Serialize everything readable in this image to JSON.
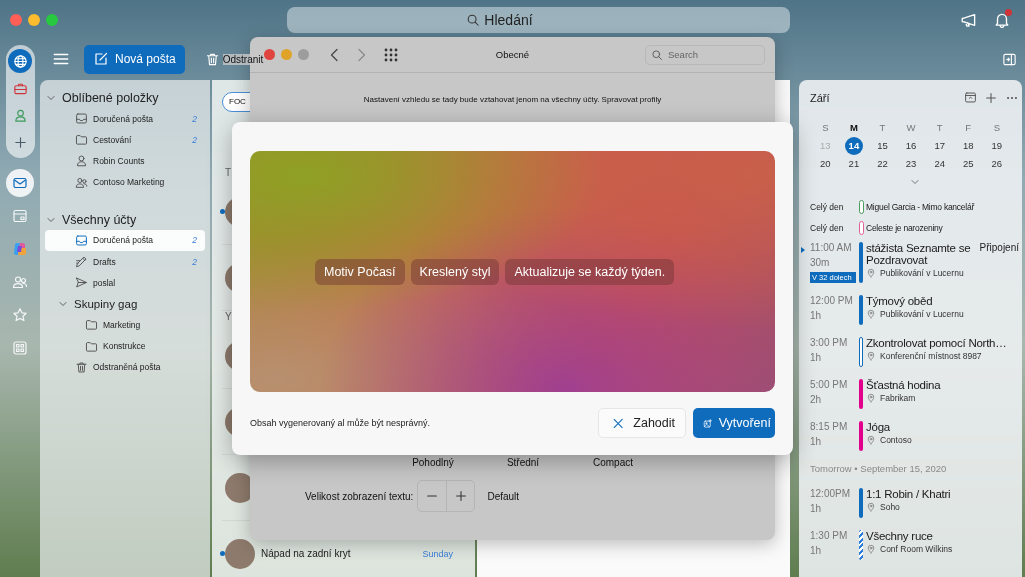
{
  "search": {
    "placeholder": "Hledání"
  },
  "notifications": {
    "alert": true
  },
  "rail": {
    "accounts": [
      {
        "kind": "globe",
        "selected": true
      },
      {
        "kind": "briefcase",
        "selected": false
      },
      {
        "kind": "person",
        "selected": false
      },
      {
        "kind": "add",
        "selected": false
      }
    ],
    "apps": [
      {
        "kind": "mail",
        "selected": true
      },
      {
        "kind": "calendar",
        "selected": false
      },
      {
        "kind": "copilot",
        "selected": false
      },
      {
        "kind": "people",
        "selected": false
      },
      {
        "kind": "star",
        "selected": false
      },
      {
        "kind": "apps",
        "selected": false
      }
    ]
  },
  "toolbar": {
    "new_mail": "Nová pošta",
    "delete": "Odstranit"
  },
  "folders": [
    {
      "label": "Oblíbené položky",
      "expanded": true,
      "children": [
        {
          "label": "Doručená pošta",
          "kind": "inbox",
          "count": "2",
          "selected": false
        },
        {
          "label": "Cestování",
          "kind": "folder",
          "count": "2",
          "selected": false
        },
        {
          "label": "Robin Counts",
          "kind": "person",
          "selected": false
        },
        {
          "label": "Contoso Marketing",
          "kind": "group",
          "selected": false
        }
      ]
    },
    {
      "label": "Všechny účty",
      "expanded": true,
      "children": [
        {
          "label": "Doručená pošta",
          "kind": "inbox",
          "count": "2",
          "selected": true
        },
        {
          "label": "Drafts",
          "kind": "drafts",
          "count": "2",
          "selected": false
        },
        {
          "label": "poslal",
          "kind": "sent",
          "selected": false
        },
        {
          "label": "Skupiny gag",
          "kind": "subgroup",
          "expanded": true,
          "children": [
            {
              "label": "Marketing",
              "kind": "folder",
              "selected": false
            },
            {
              "label": "Konstrukce",
              "kind": "folder",
              "selected": false
            }
          ]
        },
        {
          "label": "Odstraněná pošta",
          "kind": "trash",
          "selected": false
        }
      ]
    }
  ],
  "message_list": {
    "filter": "FOC",
    "groups": [
      {
        "label": "T",
        "messages": [
          {
            "unread": true
          },
          {
            "unread": false
          }
        ]
      },
      {
        "label": "Y",
        "messages": [
          {
            "unread": false
          },
          {
            "unread": false
          },
          {
            "unread": false
          },
          {
            "unread": true,
            "subject": "Nápad na zadní kryt",
            "time": "Sunday"
          }
        ]
      }
    ]
  },
  "settings_window": {
    "title": "Obecné",
    "search": {
      "placeholder": "Search"
    },
    "notice": "Nastavení vzhledu se tady bude vztahovat jenom na všechny účty. Spravovat profily",
    "density_options": [
      "Pohodlný",
      "Střední",
      "Compact"
    ],
    "text_size": {
      "label": "Velikost zobrazení textu:",
      "value": "Default"
    }
  },
  "ai_dialog": {
    "chips": [
      "Motiv Počasí",
      "Kreslený styl",
      "Aktualizuje se každý týden."
    ],
    "disclaimer": "Obsah vygenerovaný al může být nesprávný.",
    "buttons": [
      {
        "label": "Zahodit",
        "kind": "discard"
      },
      {
        "label": "Vytvoření",
        "kind": "create"
      }
    ]
  },
  "calendar": {
    "month": "Září",
    "weekdays": [
      {
        "label": "S",
        "selected": false
      },
      {
        "label": "M",
        "selected": true
      },
      {
        "label": "T",
        "selected": false
      },
      {
        "label": "W",
        "selected": false
      },
      {
        "label": "T",
        "selected": false
      },
      {
        "label": "F",
        "selected": false
      },
      {
        "label": "S",
        "selected": false
      }
    ],
    "weeks": [
      [
        {
          "label": "13",
          "muted": true,
          "selected": false
        },
        {
          "label": "14",
          "muted": false,
          "selected": true
        },
        {
          "label": "15",
          "muted": false,
          "selected": false
        },
        {
          "label": "16",
          "muted": false,
          "selected": false
        },
        {
          "label": "17",
          "muted": false,
          "selected": false
        },
        {
          "label": "18",
          "muted": false,
          "selected": false
        },
        {
          "label": "19",
          "muted": false,
          "selected": false
        }
      ],
      [
        {
          "label": "20",
          "muted": false,
          "selected": false
        },
        {
          "label": "21",
          "muted": false,
          "selected": false
        },
        {
          "label": "22",
          "muted": false,
          "selected": false
        },
        {
          "label": "23",
          "muted": false,
          "selected": false
        },
        {
          "label": "24",
          "muted": false,
          "selected": false
        },
        {
          "label": "25",
          "muted": false,
          "selected": false
        },
        {
          "label": "26",
          "muted": false,
          "selected": false
        }
      ]
    ],
    "days": [
      {
        "events": [
          {
            "kind": "all_day",
            "time": "Celý den",
            "title": "Miguel Garcia - Mimo kancelář",
            "bar": {
              "kind": "outline"
            },
            "color": "#4a9c5d",
            "now": false
          },
          {
            "kind": "all_day",
            "time": "Celý den",
            "title": "Celeste je narozeniny",
            "bar": {
              "kind": "outline"
            },
            "color": "#e0609a",
            "now": false
          },
          {
            "kind": "timed",
            "time": "11:00 AM",
            "duration": "30m",
            "title": "stážista Seznamte se Pozdravovat",
            "location": "Publikování v Lucernu",
            "join": "Připojení",
            "badge": "V 32 dolech",
            "bar": {
              "kind": "solid"
            },
            "color": "#0f6cbd",
            "now": true
          },
          {
            "kind": "timed",
            "time": "12:00 PM",
            "duration": "1h",
            "title": "Týmový oběd",
            "location": "Publikování v Lucernu",
            "bar": {
              "kind": "solid"
            },
            "color": "#0f6cbd",
            "now": false
          },
          {
            "kind": "timed",
            "time": "3:00 PM",
            "duration": "1h",
            "title": "Zkontrolovat pomocí North…",
            "location": "Konferenční místnost 8987",
            "bar": {
              "kind": "outline"
            },
            "color": "#0f6cbd",
            "now": false
          },
          {
            "kind": "timed",
            "time": "5:00 PM",
            "duration": "2h",
            "title": "Šťastná hodina",
            "location": "Fabrikam",
            "bar": {
              "kind": "solid"
            },
            "color": "#e3008c",
            "now": false
          },
          {
            "kind": "timed",
            "time": "8:15 PM",
            "duration": "1h",
            "title": "Jóga",
            "location": "Contoso",
            "bar": {
              "kind": "solid"
            },
            "color": "#e3008c",
            "now": false
          }
        ]
      },
      {
        "header": "Tomorrow • September 15, 2020",
        "events": [
          {
            "kind": "timed",
            "time": "12:00PM",
            "duration": "1h",
            "title": "1:1 Robin / Khatri",
            "location": "Soho",
            "bar": {
              "kind": "solid"
            },
            "color": "#0f6cbd",
            "now": false
          },
          {
            "kind": "timed",
            "time": "1:30 PM",
            "duration": "1h",
            "title": "Všechny ruce",
            "location": "Conf Room Wilkins",
            "bar": {
              "kind": "striped"
            },
            "color": "#2b7fd8",
            "now": false
          }
        ]
      }
    ]
  }
}
